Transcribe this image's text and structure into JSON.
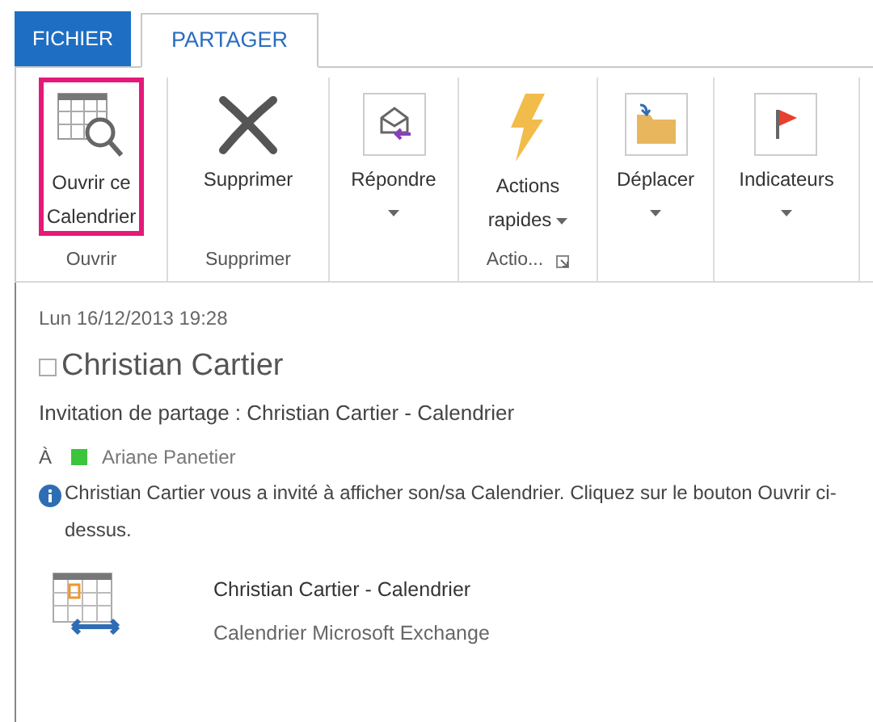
{
  "tabs": [
    {
      "label": "FICHIER",
      "kind": "file",
      "selected": false
    },
    {
      "label": "PARTAGER",
      "kind": "tab",
      "selected": true
    }
  ],
  "ribbon_groups": [
    {
      "label": "Ouvrir",
      "launcher": false,
      "buttons": [
        {
          "lines": [
            "Ouvrir ce",
            "Calendrier"
          ],
          "kind": "large",
          "highlighted": true,
          "has_menu": false
        }
      ]
    },
    {
      "label": "Supprimer",
      "launcher": false,
      "buttons": [
        {
          "lines": [
            "Supprimer"
          ],
          "kind": "large",
          "highlighted": false,
          "has_menu": false
        }
      ]
    },
    {
      "launcher": false,
      "buttons": [
        {
          "lines": [
            "Répondre"
          ],
          "kind": "large",
          "highlighted": false,
          "has_menu": true
        }
      ]
    },
    {
      "label": "Actio...",
      "launcher": true,
      "buttons": [
        {
          "lines": [
            "Actions",
            "rapides"
          ],
          "kind": "large",
          "highlighted": false,
          "has_menu": true
        }
      ]
    },
    {
      "launcher": false,
      "buttons": [
        {
          "lines": [
            "Déplacer"
          ],
          "kind": "large",
          "highlighted": false,
          "has_menu": true
        }
      ]
    },
    {
      "launcher": false,
      "buttons": [
        {
          "lines": [
            "Indicateurs"
          ],
          "kind": "large",
          "highlighted": false,
          "has_menu": true
        }
      ]
    }
  ],
  "message": {
    "date": "Lun 16/12/2013 19:28",
    "sender": "Christian Cartier",
    "sender_checked": false,
    "subject": "Invitation de partage : Christian Cartier - Calendrier",
    "to_label": "À",
    "recipients": [
      {
        "name": "Ariane Panetier",
        "color": "#3cc43c"
      }
    ],
    "info": "Christian Cartier vous a invité à afficher son/sa Calendrier.  Cliquez sur le bouton Ouvrir ci-dessus.",
    "attachment": {
      "title": "Christian Cartier - Calendrier",
      "subtitle": "Calendrier Microsoft Exchange"
    }
  }
}
